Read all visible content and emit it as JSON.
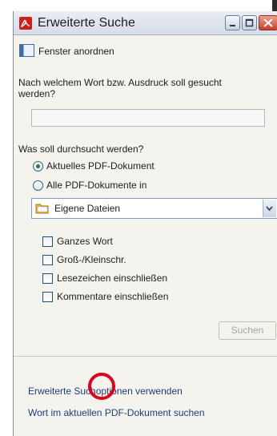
{
  "window": {
    "title": "Erweiterte Suche",
    "controls": {
      "minimize": "minimize-icon",
      "maximize": "maximize-icon",
      "close": "close-icon"
    }
  },
  "toolbar": {
    "arrange_label": "Fenster anordnen"
  },
  "form": {
    "question": "Nach welchem Wort bzw. Ausdruck soll gesucht werden?",
    "search_value": "",
    "scope_question": "Was soll durchsucht werden?",
    "scope_options": [
      {
        "label": "Aktuelles PDF-Dokument",
        "checked": true
      },
      {
        "label": "Alle PDF-Dokumente in",
        "checked": false
      }
    ],
    "location_select": "Eigene Dateien",
    "options": [
      {
        "label": "Ganzes Wort",
        "checked": false
      },
      {
        "label": "Groß-/Kleinschr.",
        "checked": false
      },
      {
        "label": "Lesezeichen einschließen",
        "checked": false
      },
      {
        "label": "Kommentare einschließen",
        "checked": false
      }
    ],
    "search_button": "Suchen"
  },
  "footer": {
    "advanced_link": "Erweiterte Suchoptionen verwenden",
    "current_doc_link": "Wort im aktuellen PDF-Dokument suchen"
  },
  "colors": {
    "highlight_circle": "#e0001b",
    "link": "#1c3f7a",
    "title_bar": "#dde3ec"
  }
}
